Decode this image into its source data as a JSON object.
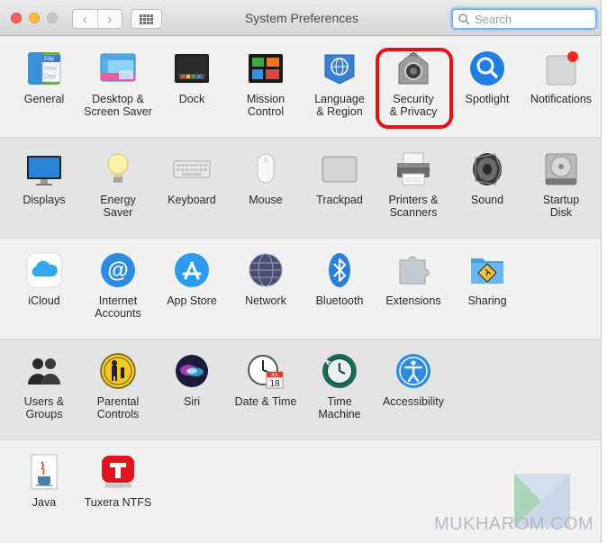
{
  "window": {
    "title": "System Preferences"
  },
  "toolbar": {
    "back_glyph": "‹",
    "forward_glyph": "›",
    "grid_icon": "show-all-grid-icon"
  },
  "search": {
    "placeholder": "Search",
    "value": ""
  },
  "sections": [
    {
      "items": [
        {
          "label": "General",
          "icon": "general-icon"
        },
        {
          "label": "Desktop &\nScreen Saver",
          "icon": "desktop-screensaver-icon"
        },
        {
          "label": "Dock",
          "icon": "dock-icon"
        },
        {
          "label": "Mission\nControl",
          "icon": "mission-control-icon"
        },
        {
          "label": "Language\n& Region",
          "icon": "language-region-icon"
        },
        {
          "label": "Security\n& Privacy",
          "icon": "security-privacy-icon",
          "highlighted": true
        },
        {
          "label": "Spotlight",
          "icon": "spotlight-icon"
        },
        {
          "label": "Notifications",
          "icon": "notifications-icon"
        }
      ]
    },
    {
      "items": [
        {
          "label": "Displays",
          "icon": "displays-icon"
        },
        {
          "label": "Energy\nSaver",
          "icon": "energy-saver-icon"
        },
        {
          "label": "Keyboard",
          "icon": "keyboard-icon"
        },
        {
          "label": "Mouse",
          "icon": "mouse-icon"
        },
        {
          "label": "Trackpad",
          "icon": "trackpad-icon"
        },
        {
          "label": "Printers &\nScanners",
          "icon": "printers-scanners-icon"
        },
        {
          "label": "Sound",
          "icon": "sound-icon"
        },
        {
          "label": "Startup\nDisk",
          "icon": "startup-disk-icon"
        }
      ]
    },
    {
      "items": [
        {
          "label": "iCloud",
          "icon": "icloud-icon"
        },
        {
          "label": "Internet\nAccounts",
          "icon": "internet-accounts-icon"
        },
        {
          "label": "App Store",
          "icon": "app-store-icon"
        },
        {
          "label": "Network",
          "icon": "network-icon"
        },
        {
          "label": "Bluetooth",
          "icon": "bluetooth-icon"
        },
        {
          "label": "Extensions",
          "icon": "extensions-icon"
        },
        {
          "label": "Sharing",
          "icon": "sharing-icon"
        }
      ]
    },
    {
      "items": [
        {
          "label": "Users &\nGroups",
          "icon": "users-groups-icon"
        },
        {
          "label": "Parental\nControls",
          "icon": "parental-controls-icon"
        },
        {
          "label": "Siri",
          "icon": "siri-icon"
        },
        {
          "label": "Date & Time",
          "icon": "date-time-icon"
        },
        {
          "label": "Time\nMachine",
          "icon": "time-machine-icon"
        },
        {
          "label": "Accessibility",
          "icon": "accessibility-icon"
        }
      ]
    },
    {
      "items": [
        {
          "label": "Java",
          "icon": "java-icon"
        },
        {
          "label": "Tuxera NTFS",
          "icon": "tuxera-ntfs-icon"
        }
      ]
    }
  ],
  "general_icon_text": [
    "File",
    "New",
    "Ope"
  ],
  "date_icon_text": {
    "month": "JUL",
    "day": "18"
  },
  "watermark": "MUKHAROM.COM",
  "colors": {
    "highlight": "#e5121c",
    "search_focus": "#7fb0ea",
    "window_bg": "#ececec"
  }
}
